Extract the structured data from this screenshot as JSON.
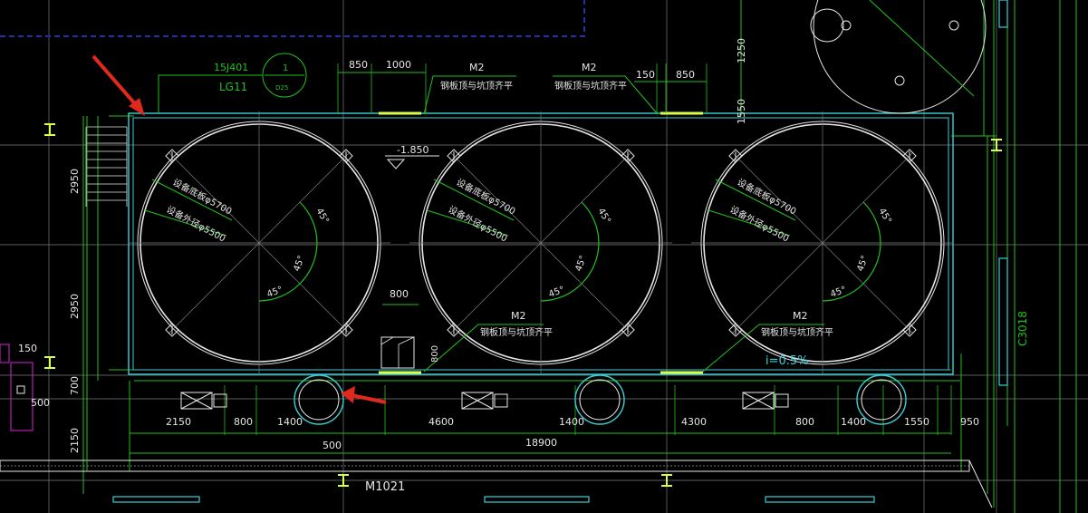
{
  "colors": {
    "background": "#000000",
    "green": "#22c01e",
    "white": "#e6e6e6",
    "cyan": "#3ad0d8",
    "navy": "#2b2ea8",
    "gray": "#7a7a7a",
    "yellowgreen": "#d8ff4a",
    "red": "#e0291d",
    "magenta": "#b51db5"
  },
  "callouts": {
    "ref_code": "15J401",
    "ref_sub": "LG11",
    "ref_num": "1",
    "ref_sheet": "D25",
    "elevation": "-1.850",
    "slope": "i=0.5%",
    "door_label": "M1021",
    "right_label": "C3018"
  },
  "plate_labels": [
    {
      "tag": "M2",
      "note": "钢板顶与坑顶齐平"
    },
    {
      "tag": "M2",
      "note": "钢板顶与坑顶齐平"
    },
    {
      "tag": "M2",
      "note": "钢板顶与坑顶齐平"
    },
    {
      "tag": "M2",
      "note": "钢板顶与坑顶齐平"
    }
  ],
  "tank": {
    "base_label": "设备底板φ5700",
    "outer_label": "设备外径φ5500",
    "angle": "45°"
  },
  "dimensions": {
    "top": [
      "850",
      "1000",
      "150",
      "850"
    ],
    "left": [
      "2950",
      "2950",
      "700",
      "2150"
    ],
    "bottom_row": [
      "2150",
      "800",
      "1400",
      "4600",
      "1400",
      "4300",
      "800",
      "1400",
      "1550",
      "950"
    ],
    "bottom_extra": "500",
    "total": "18900",
    "gap": "800",
    "gap_v": "800",
    "right_top": [
      "1250",
      "1550"
    ],
    "small_left": [
      "150",
      "500"
    ]
  },
  "icons": [
    "north-arrow-icon",
    "pointer-arrow-icon",
    "column-icon",
    "pipe-icon",
    "fan-unit-icon"
  ]
}
